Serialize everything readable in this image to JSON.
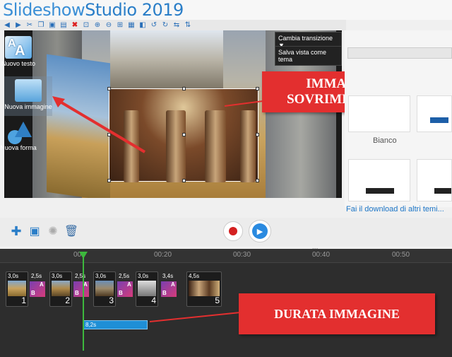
{
  "app": {
    "title_part1": "Slideshow",
    "title_part2": "Studio",
    "title_year": " 2019"
  },
  "toolbar": {
    "icons": [
      "back-icon",
      "forward-icon",
      "cut-icon",
      "copy-icon",
      "paste-icon",
      "paste-special-icon",
      "delete-icon",
      "zoom-fit-icon",
      "zoom-in-icon",
      "zoom-out-icon",
      "zoom-select-icon",
      "grid-icon",
      "layer-icon",
      "rotate-left-icon",
      "rotate-right-icon",
      "flip-icon",
      "flip-v-icon"
    ]
  },
  "preview": {
    "transition_button": "Cambia transizione",
    "save_theme_button": "Salva vista come tema"
  },
  "side_panel": {
    "items": [
      {
        "label": "Nuovo testo",
        "icon": "text-icon"
      },
      {
        "label": "Nuova immagine",
        "icon": "image-icon"
      },
      {
        "label": "Nuova forma",
        "icon": "shape-icon"
      }
    ]
  },
  "right_panel": {
    "tile_label": "Bianco",
    "download_link": "Fai il download di altri temi..."
  },
  "timeline": {
    "ruler": [
      "00",
      "00:20",
      "00:30",
      "00:40",
      "00:50"
    ],
    "clips": [
      {
        "duration": "3,0s",
        "number": "1"
      },
      {
        "duration": "3,0s",
        "number": "2"
      },
      {
        "duration": "3,0s",
        "number": "3"
      },
      {
        "duration": "3,0s",
        "number": "4"
      },
      {
        "duration": "4,5s",
        "number": "5"
      }
    ],
    "transitions": [
      {
        "duration": "2,5s",
        "a": "A",
        "b": "B"
      },
      {
        "duration": "2,5s",
        "a": "A",
        "b": "B"
      },
      {
        "duration": "2,5s",
        "a": "A",
        "b": "B"
      },
      {
        "duration": "3,4s",
        "a": "A",
        "b": "B"
      }
    ],
    "overlay_clip": "8,2s"
  },
  "callouts": {
    "overlay_image": "IMMAGINE IN SOVRIMPRESSIONE",
    "image_duration": "DURATA IMMAGINE"
  },
  "colors": {
    "accent": "#2a7ec8",
    "callout": "#e32f2f",
    "playhead": "#3db83d"
  }
}
